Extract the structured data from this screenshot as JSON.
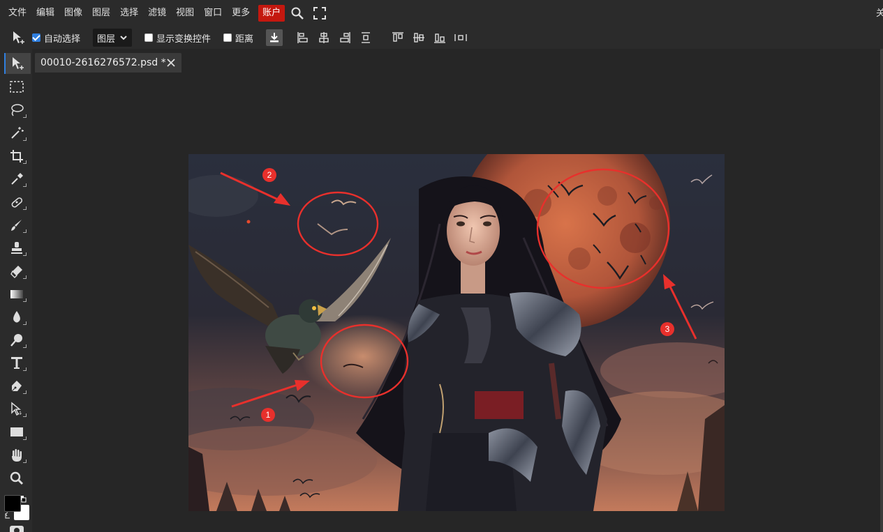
{
  "menu": {
    "items": [
      "文件",
      "编辑",
      "图像",
      "图层",
      "选择",
      "滤镜",
      "视图",
      "窗口",
      "更多"
    ],
    "account": "账户",
    "edge_glyph": "关"
  },
  "options": {
    "auto_select_label": "自动选择",
    "auto_select_checked": true,
    "layer_dropdown": "图层",
    "show_transform_label": "显示变换控件",
    "show_transform_checked": false,
    "distance_label": "距离",
    "distance_checked": false
  },
  "tools": [
    "move-tool",
    "marquee-tool",
    "lasso-tool",
    "magic-wand-tool",
    "crop-tool",
    "eyedropper-tool",
    "healing-brush-tool",
    "brush-tool",
    "stamp-tool",
    "eraser-tool",
    "gradient-tool",
    "blur-tool",
    "dodge-tool",
    "type-tool",
    "pen-tool",
    "path-select-tool",
    "shape-tool",
    "hand-tool",
    "zoom-tool"
  ],
  "tab": {
    "filename": "00010-2616276572.psd *"
  },
  "annotations": [
    {
      "label": "1"
    },
    {
      "label": "2"
    },
    {
      "label": "3"
    }
  ],
  "colors": {
    "accent": "#2f7fe0",
    "account_bg": "#c4180f",
    "annotation_red": "#e8302c",
    "foreground": "#000000",
    "background": "#ffffff"
  }
}
